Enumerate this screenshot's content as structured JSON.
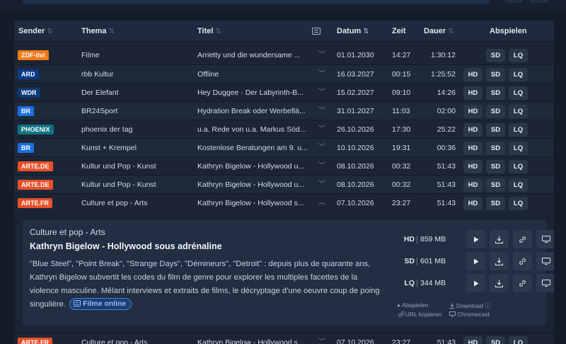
{
  "columns": {
    "sender": "Sender",
    "thema": "Thema",
    "titel": "Titel",
    "datum": "Datum",
    "zeit": "Zeit",
    "dauer": "Dauer",
    "abspielen": "Abspielen"
  },
  "rows": [
    {
      "sender": "ZDF-tivi",
      "color": "#f07a1a",
      "thema": "Filme",
      "titel": "Arrietty und die wundersame ...",
      "datum": "01.01.2030",
      "zeit": "14:27",
      "dauer": "1:30:12",
      "hd": false,
      "expanded": false
    },
    {
      "sender": "ARD",
      "color": "#0a3a8a",
      "thema": "rbb Kultur",
      "titel": "Offline",
      "datum": "16.03.2027",
      "zeit": "00:15",
      "dauer": "1:25:52",
      "hd": true,
      "expanded": false
    },
    {
      "sender": "WDR",
      "color": "#0b3a76",
      "thema": "Der Elefant",
      "titel": "Hey Duggee · Der Labyrinth-B...",
      "datum": "15.02.2027",
      "zeit": "09:10",
      "dauer": "14:26",
      "hd": true,
      "expanded": false
    },
    {
      "sender": "BR",
      "color": "#1b6fe0",
      "thema": "BR24Sport",
      "titel": "Hydration Break oder Werbeflä...",
      "datum": "31.01.2027",
      "zeit": "11:03",
      "dauer": "02:00",
      "hd": true,
      "expanded": false
    },
    {
      "sender": "PHOENIX",
      "color": "#0e7380",
      "thema": "phoenix der tag",
      "titel": "u.a. Rede von u.a. Markus Söd...",
      "datum": "26.10.2026",
      "zeit": "17:30",
      "dauer": "25:22",
      "hd": true,
      "expanded": false
    },
    {
      "sender": "BR",
      "color": "#1b6fe0",
      "thema": "Kunst + Krempel",
      "titel": "Kostenlose Beratungen am 9. u...",
      "datum": "10.10.2026",
      "zeit": "19:31",
      "dauer": "00:36",
      "hd": true,
      "expanded": false
    },
    {
      "sender": "ARTE.DE",
      "color": "#e8502a",
      "thema": "Kultur und Pop - Kunst",
      "titel": "Kathryn Bigelow - Hollywood u...",
      "datum": "08.10.2026",
      "zeit": "00:32",
      "dauer": "51:43",
      "hd": true,
      "expanded": false
    },
    {
      "sender": "ARTE.DE",
      "color": "#e8502a",
      "thema": "Kultur und Pop - Kunst",
      "titel": "Kathryn Bigelow - Hollywood u...",
      "datum": "08.10.2026",
      "zeit": "00:32",
      "dauer": "51:43",
      "hd": true,
      "expanded": false
    },
    {
      "sender": "ARTE.FR",
      "color": "#e8502a",
      "thema": "Culture et pop - Arts",
      "titel": "Kathryn Bigelow - Hollywood s...",
      "datum": "07.10.2026",
      "zeit": "23:27",
      "dauer": "51:43",
      "hd": true,
      "expanded": true
    }
  ],
  "partial_row": {
    "sender": "ARTE.FR",
    "color": "#e8502a",
    "thema": "Culture et pop - Arts",
    "titel": "Kathryn Bigelow - Hollywood s...",
    "datum": "07.10.2026",
    "zeit": "23:27",
    "dauer": "51:43"
  },
  "buttons": {
    "hd": "HD",
    "sd": "SD",
    "lq": "LQ"
  },
  "detail": {
    "thema": "Culture et pop - Arts",
    "title": "Kathryn Bigelow - Hollywood sous adrénaline",
    "description": "\"Blue Steel\", \"Point Break\", \"Strange Days\", \"Démineurs\", \"Detroit\" : depuis plus de quarante ans, Kathryn Bigelow subvertit les codes du film de genre pour explorer les multiples facettes de la violence masculine. Mêlant interviews et extraits de films, le décryptage d'une oeuvre coup de poing singulière.",
    "link_label": "Filme online",
    "qualities": [
      {
        "label": "HD",
        "size": "859 MB"
      },
      {
        "label": "SD",
        "size": "601 MB"
      },
      {
        "label": "LQ",
        "size": "344 MB"
      }
    ],
    "legend": {
      "play": "Abspielen",
      "download": "Download",
      "copy": "URL kopieren",
      "cast": "Chromecast"
    }
  }
}
